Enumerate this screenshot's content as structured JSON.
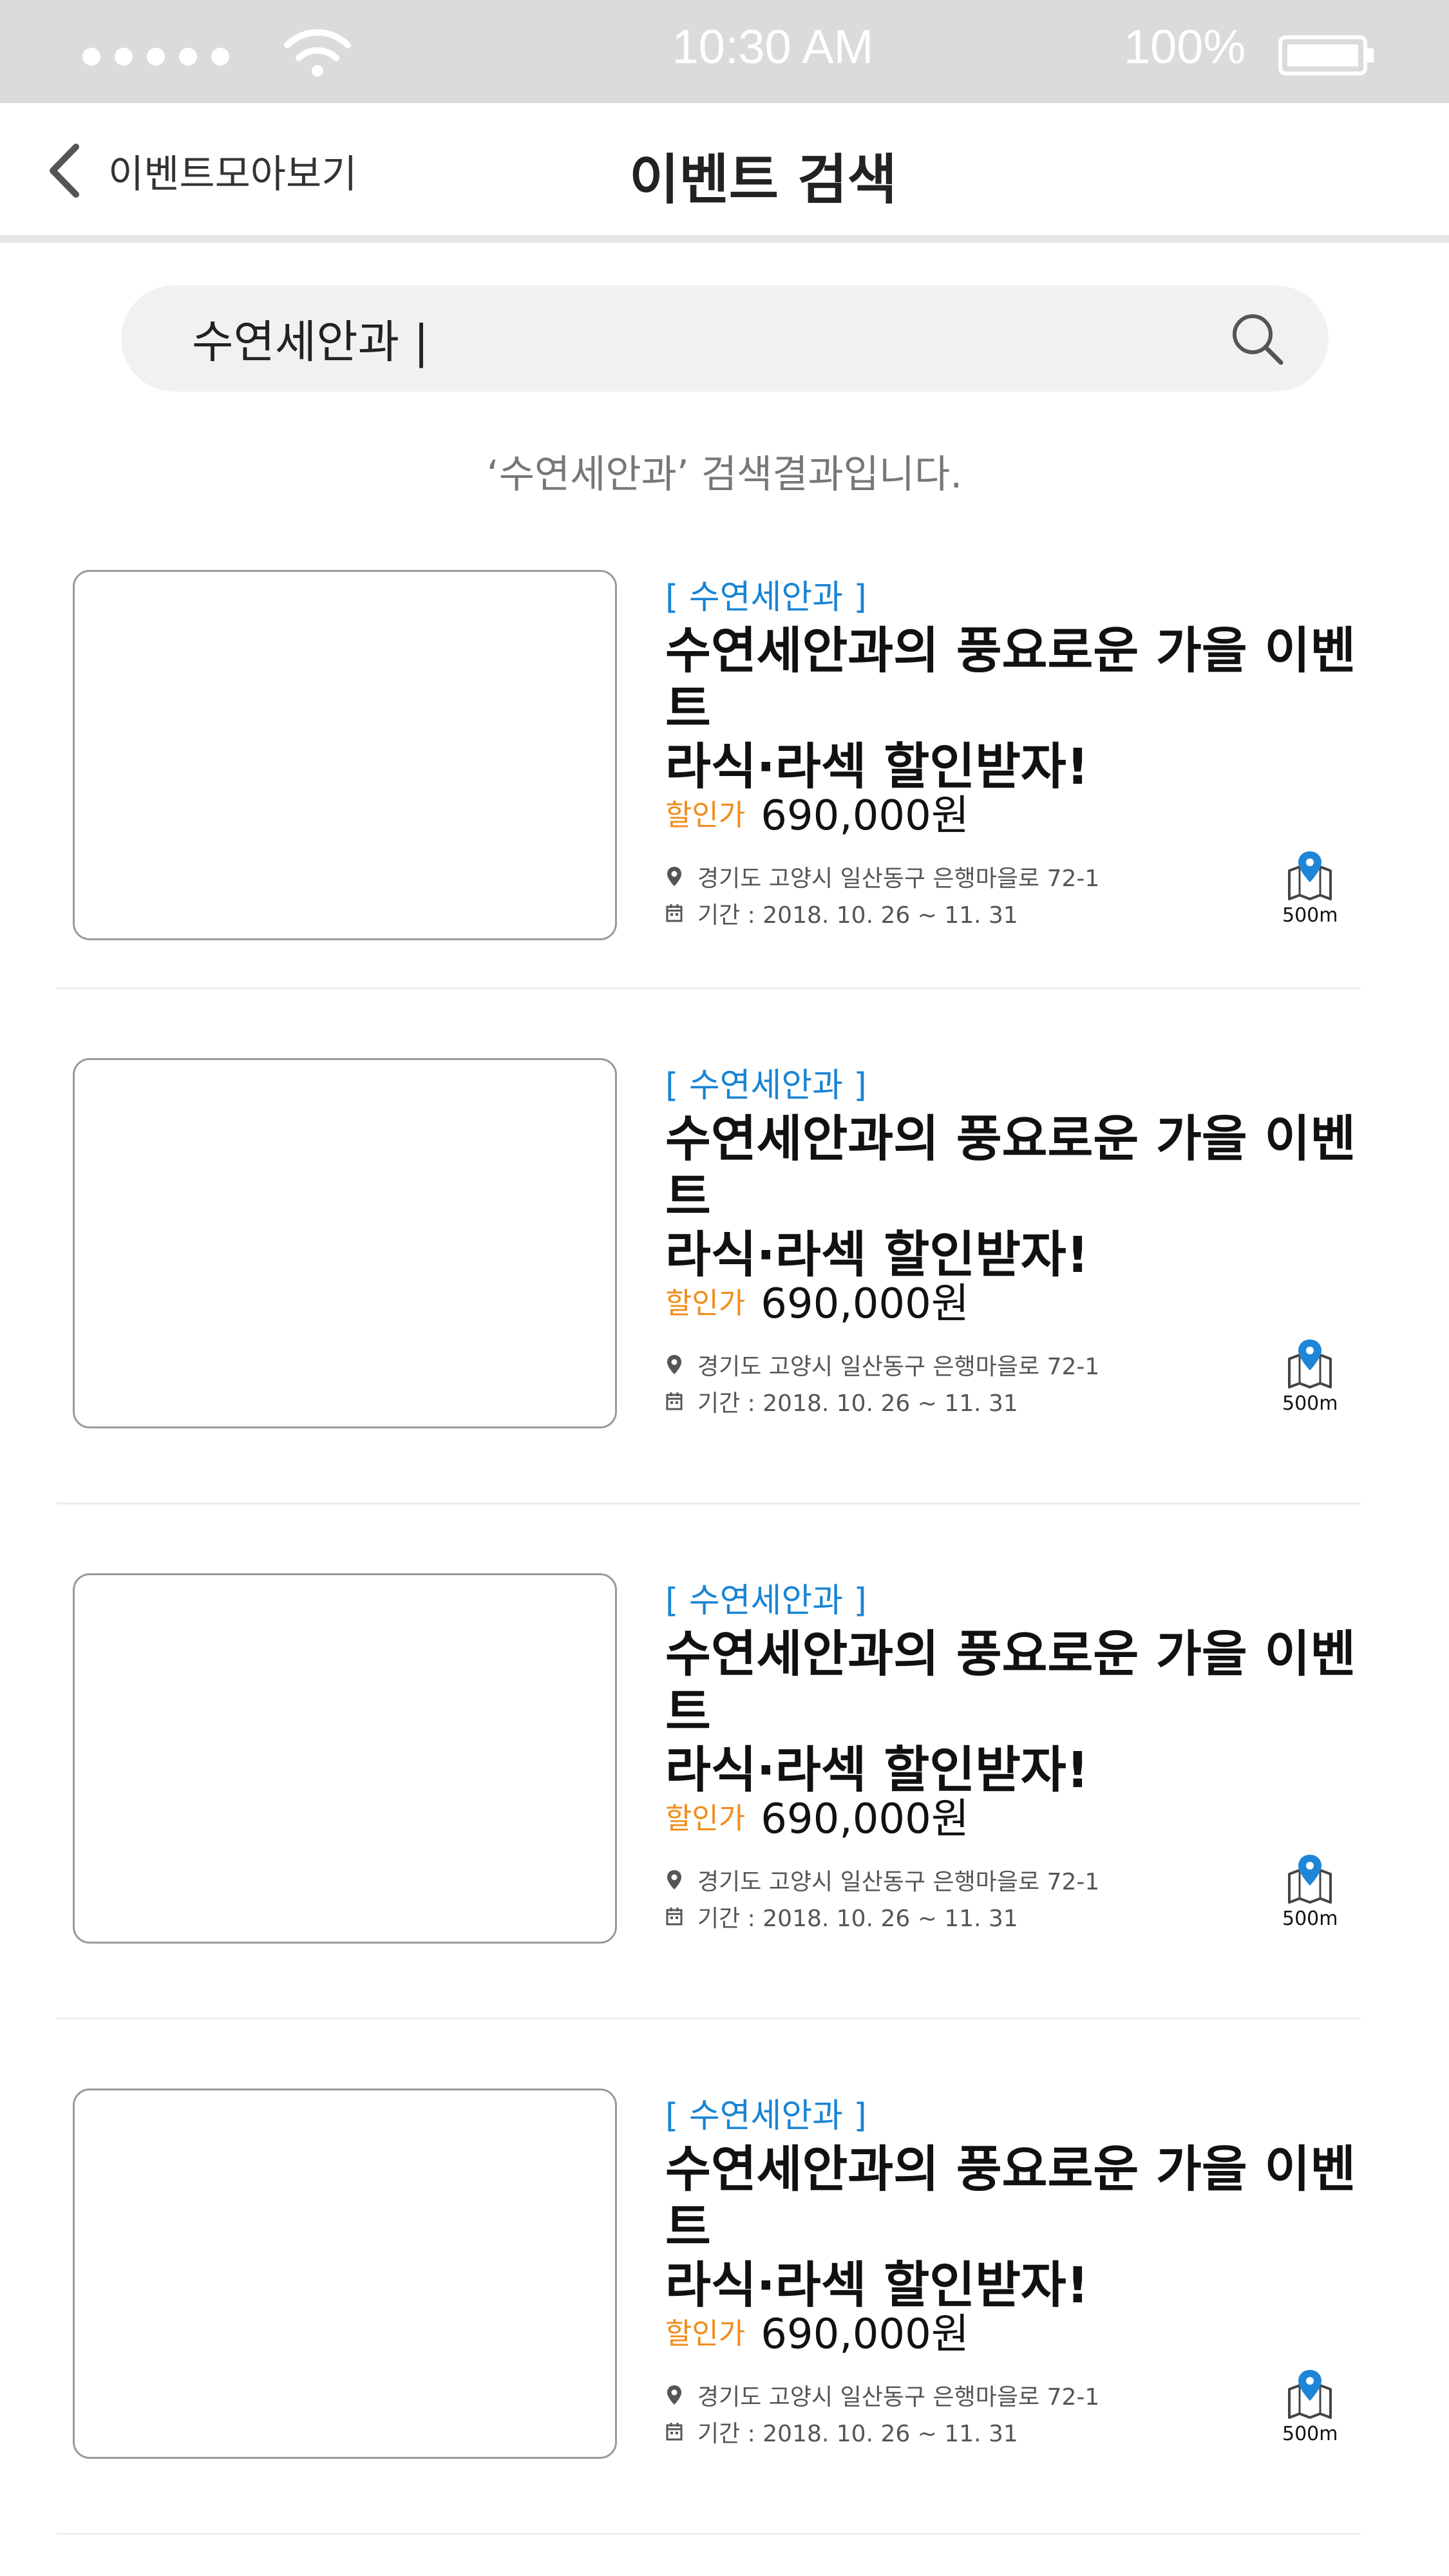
{
  "status_bar": {
    "time": "10:30 AM",
    "battery": "100%",
    "icons": [
      "signal-dots-icon",
      "wifi-icon",
      "battery-icon"
    ]
  },
  "nav": {
    "back_label": "이벤트모아보기",
    "title": "이벤트 검색",
    "back_icon": "chevron-left-icon"
  },
  "search": {
    "value": "수연세안과 |",
    "icon": "search-icon"
  },
  "result_text": "‘수연세안과’ 검색결과입니다.",
  "accent_colors": {
    "tag": "#1a84d4",
    "price_label": "#f08c1a",
    "map_pin": "#1e86d8"
  },
  "results": [
    {
      "tag": "[ 수연세안과 ]",
      "title_line1": "수연세안과의 풍요로운 가을 이벤트",
      "title_line2": "라식·라섹 할인받자!",
      "price_label": "할인가",
      "price": "690,000원",
      "address": "경기도 고양시 일산동구 은행마을로 72-1",
      "period": "기간 : 2018. 10. 26 ~ 11. 31",
      "distance": "500m"
    },
    {
      "tag": "[ 수연세안과 ]",
      "title_line1": "수연세안과의 풍요로운 가을 이벤트",
      "title_line2": "라식·라섹 할인받자!",
      "price_label": "할인가",
      "price": "690,000원",
      "address": "경기도 고양시 일산동구 은행마을로 72-1",
      "period": "기간 : 2018. 10. 26 ~ 11. 31",
      "distance": "500m"
    },
    {
      "tag": "[ 수연세안과 ]",
      "title_line1": "수연세안과의 풍요로운 가을 이벤트",
      "title_line2": "라식·라섹 할인받자!",
      "price_label": "할인가",
      "price": "690,000원",
      "address": "경기도 고양시 일산동구 은행마을로 72-1",
      "period": "기간 : 2018. 10. 26 ~ 11. 31",
      "distance": "500m"
    },
    {
      "tag": "[ 수연세안과 ]",
      "title_line1": "수연세안과의 풍요로운 가을 이벤트",
      "title_line2": "라식·라섹 할인받자!",
      "price_label": "할인가",
      "price": "690,000원",
      "address": "경기도 고양시 일산동구 은행마을로 72-1",
      "period": "기간 : 2018. 10. 26 ~ 11. 31",
      "distance": "500m"
    }
  ]
}
